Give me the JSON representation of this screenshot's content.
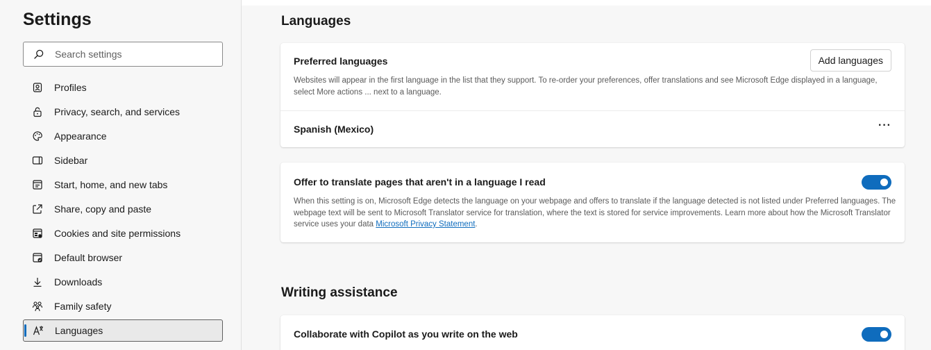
{
  "sidebar": {
    "title": "Settings",
    "search_placeholder": "Search settings",
    "items": [
      {
        "label": "Profiles",
        "icon": "profile-icon"
      },
      {
        "label": "Privacy, search, and services",
        "icon": "lock-icon"
      },
      {
        "label": "Appearance",
        "icon": "palette-icon"
      },
      {
        "label": "Sidebar",
        "icon": "sidebar-icon"
      },
      {
        "label": "Start, home, and new tabs",
        "icon": "start-home-icon"
      },
      {
        "label": "Share, copy and paste",
        "icon": "share-icon"
      },
      {
        "label": "Cookies and site permissions",
        "icon": "cookies-permissions-icon"
      },
      {
        "label": "Default browser",
        "icon": "default-browser-icon"
      },
      {
        "label": "Downloads",
        "icon": "download-icon"
      },
      {
        "label": "Family safety",
        "icon": "family-icon"
      },
      {
        "label": "Languages",
        "icon": "languages-icon",
        "active": true
      }
    ]
  },
  "languages": {
    "title": "Languages",
    "preferred": {
      "title": "Preferred languages",
      "description": "Websites will appear in the first language in the list that they support. To re-order your preferences, offer translations and see Microsoft Edge displayed in a language, select More actions ... next to a language.",
      "add_button": "Add languages",
      "language": "Spanish (Mexico)",
      "more_actions": "···"
    },
    "translate": {
      "title": "Offer to translate pages that aren't in a language I read",
      "description": "When this setting is on, Microsoft Edge detects the language on your webpage and offers to translate if the language detected is not listed under Preferred languages. The webpage text will be sent to Microsoft Translator service for translation, where the text is stored for service improvements. Learn more about how the Microsoft Translator service uses your data ",
      "link": "Microsoft Privacy Statement",
      "after_link": ".",
      "enabled": true
    }
  },
  "writing": {
    "title": "Writing assistance",
    "copilot": {
      "title": "Collaborate with Copilot as you write on the web",
      "enabled": true
    }
  },
  "colors": {
    "accent": "#0f6cbd",
    "background": "#f7f7f7",
    "card": "#ffffff"
  }
}
